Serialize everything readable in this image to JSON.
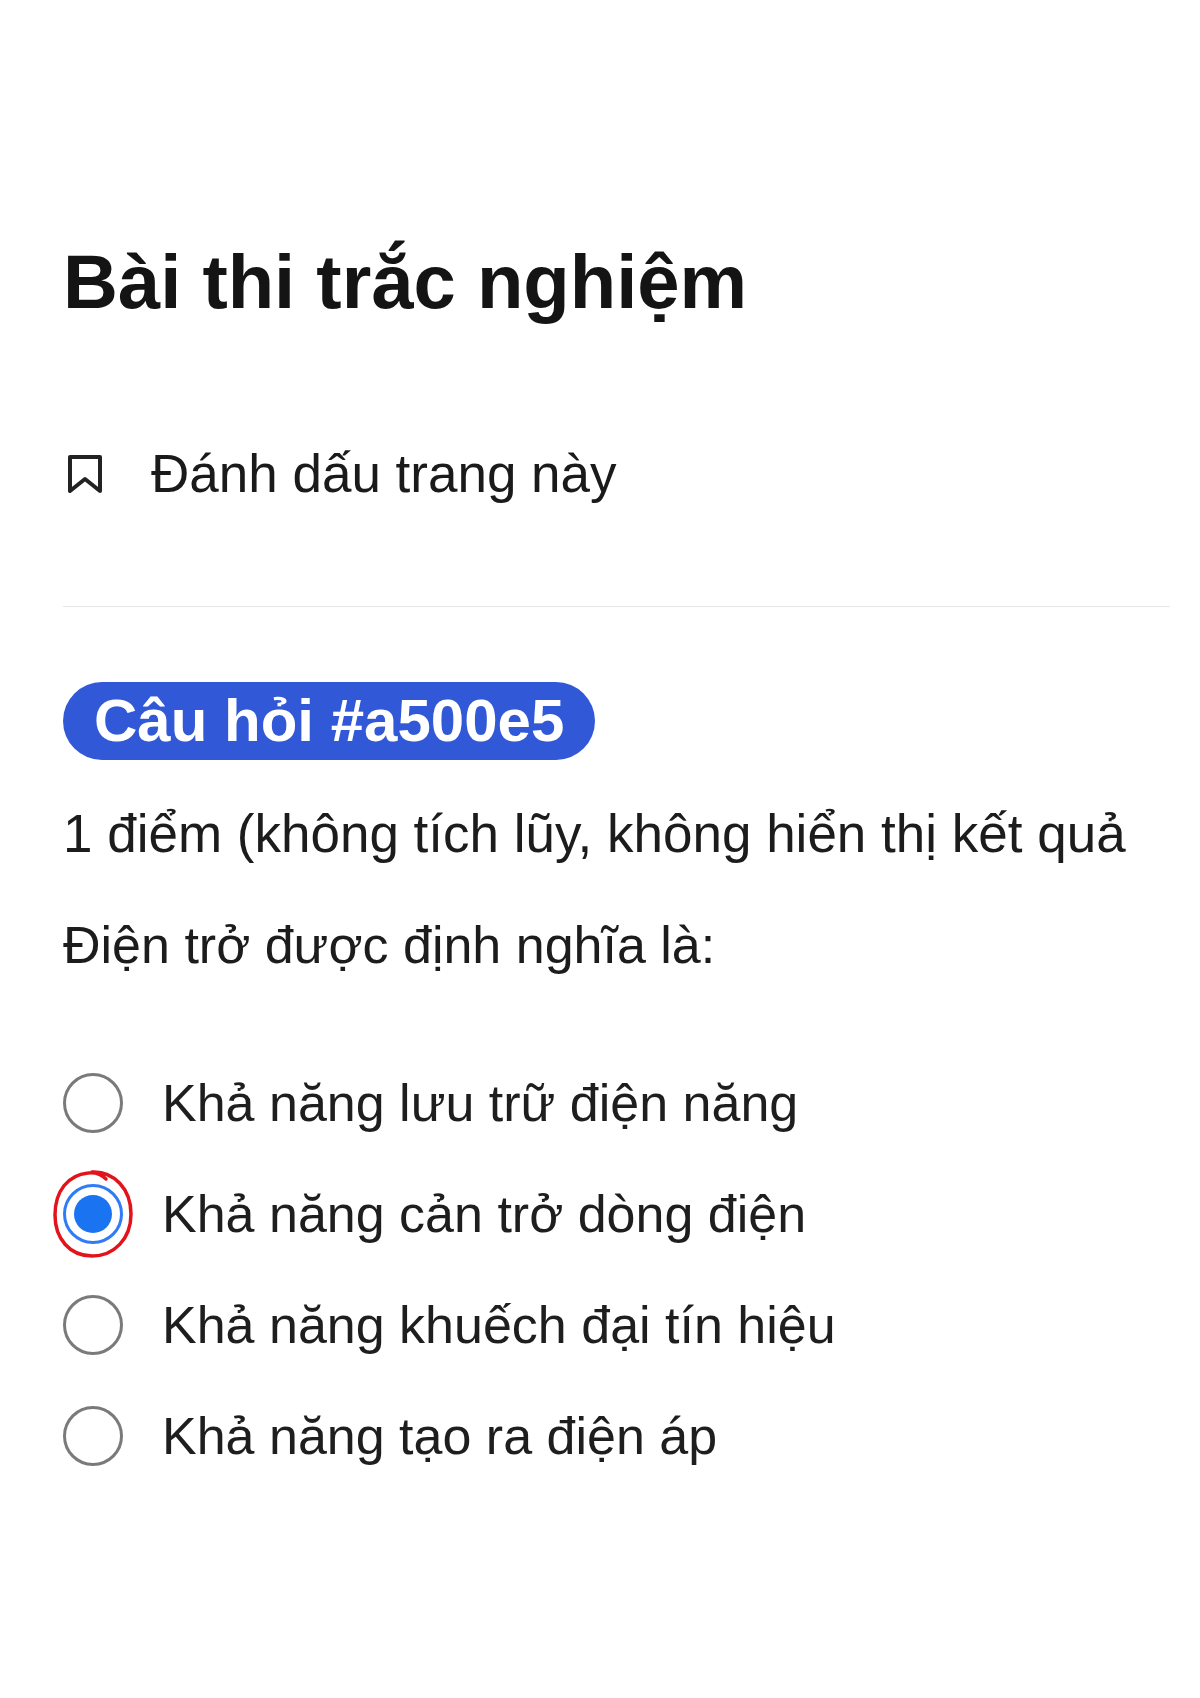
{
  "page": {
    "title": "Bài thi trắc nghiệm"
  },
  "bookmark": {
    "label": "Đánh dấu trang này"
  },
  "question": {
    "badge": "Câu hỏi #a500e5",
    "points": "1 điểm (không tích lũy, không hiển thị kết quả",
    "text": "Điện trở được định nghĩa là:",
    "options": [
      {
        "label": "Khả năng lưu trữ điện năng",
        "selected": false,
        "circled": false
      },
      {
        "label": "Khả năng cản trở dòng điện",
        "selected": true,
        "circled": true
      },
      {
        "label": "Khả năng khuếch đại tín hiệu",
        "selected": false,
        "circled": false
      },
      {
        "label": "Khả năng tạo ra điện áp",
        "selected": false,
        "circled": false
      }
    ]
  }
}
